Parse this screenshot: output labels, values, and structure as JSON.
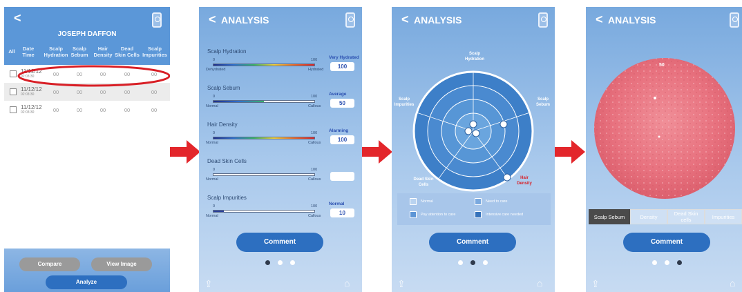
{
  "screen1": {
    "back": "<",
    "patient": "JOSEPH DAFFON",
    "columns": [
      "All",
      "Date\nTime",
      "Scalp\nHydration",
      "Scalp\nSebum",
      "Hair\nDensity",
      "Dead\nSkin Cells",
      "Scalp\nImpurities"
    ],
    "rows": [
      {
        "date": "11/12/12",
        "time": "02:03:30",
        "values": [
          "00",
          "00",
          "00",
          "00",
          "00"
        ]
      },
      {
        "date": "11/12/12",
        "time": "02:03:30",
        "values": [
          "00",
          "00",
          "00",
          "00",
          "00"
        ]
      },
      {
        "date": "11/12/12",
        "time": "02:03:30",
        "values": [
          "00",
          "00",
          "00",
          "00",
          "00"
        ]
      }
    ],
    "compare": "Compare",
    "view_image": "View Image",
    "analyze": "Analyze",
    "colors": {
      "header": "#5b97d8",
      "highlight": "#d81f26",
      "pill_gray": "#9a9a9a",
      "pill_blue": "#2d6fc0"
    }
  },
  "screen2": {
    "back": "<",
    "title": "ANALYSIS",
    "metrics": [
      {
        "label": "Scalp Hydration",
        "min": "0",
        "max": "100",
        "left_cap": "Dehydrated",
        "right_cap": "Hydrated",
        "status": "Very Hydrated",
        "value": "100",
        "fill": 1.0,
        "gradient": true
      },
      {
        "label": "Scalp Sebum",
        "min": "0",
        "max": "100",
        "left_cap": "Normal",
        "right_cap": "Callous",
        "status": "Average",
        "value": "50",
        "fill": 0.5,
        "gradient": true
      },
      {
        "label": "Hair Density",
        "min": "0",
        "max": "100",
        "left_cap": "Normal",
        "right_cap": "Callous",
        "status": "Alarming",
        "value": "100",
        "fill": 1.0,
        "gradient": true
      },
      {
        "label": "Dead Skin Cells",
        "min": "0",
        "max": "100",
        "left_cap": "Normal",
        "right_cap": "Callous",
        "status": "",
        "value": "",
        "fill": 0,
        "gradient": false
      },
      {
        "label": "Scalp Impurities",
        "min": "0",
        "max": "100",
        "left_cap": "Normal",
        "right_cap": "Callous",
        "status": "Normal",
        "value": "10",
        "fill": 0.1,
        "gradient": false
      }
    ],
    "comment": "Comment",
    "page_index": 0
  },
  "screen3": {
    "back": "<",
    "title": "ANALYSIS",
    "axes": [
      "Scalp\nHydration",
      "Scalp\nSebum",
      "Hair\nDensity",
      "Dead Skin\nCells",
      "Scalp\nImpurities"
    ],
    "legend": [
      "Normal",
      "Need to care",
      "Pay attention to care",
      "Intensive care needed"
    ],
    "comment": "Comment",
    "page_index": 1,
    "colors": {
      "hair_density_label": "#d81f26"
    }
  },
  "screen4": {
    "back": "<",
    "title": "ANALYSIS",
    "image_value": "50",
    "tabs": [
      "Scalp Sebum",
      "Density",
      "Dead Skin\ncells",
      "Impurities"
    ],
    "active_tab": 0,
    "comment": "Comment",
    "page_index": 2
  },
  "colors": {
    "arrow": "#e3262b",
    "button": "#2d6fc0",
    "dot_active": "#2f3a4c",
    "dot_inactive": "#ffffff"
  }
}
